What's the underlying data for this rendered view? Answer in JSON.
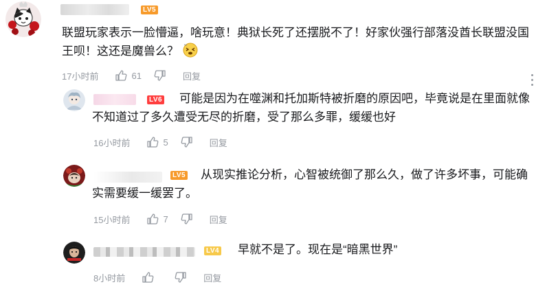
{
  "comments": [
    {
      "level": "LV5",
      "level_color": "#f79a2a",
      "text": "联盟玩家表示一脸懵逼，啥玩意！典狱长死了还摆脱不了！好家伙强行部落没酋长联盟没国王呗！这还是魔兽么？",
      "emoji_icon": "dizzy-face-emoji-icon",
      "time": "17小时前",
      "likes": "61",
      "reply_label": "回复"
    },
    {
      "level": "LV6",
      "level_color": "#ff3e3e",
      "text": "可能是因为在噬渊和托加斯特被折磨的原因吧，毕竟说是在里面就像不知道过了多久遭受无尽的折磨，受了那么多罪，缓缓也好",
      "time": "16小时前",
      "likes": "5",
      "reply_label": "回复"
    },
    {
      "level": "LV5",
      "level_color": "#f79a2a",
      "text": "从现实推论分析，心智被统御了那么久，做了许多坏事，可能确实需要缓一缓罢了。",
      "time": "15小时前",
      "likes": "7",
      "reply_label": "回复"
    },
    {
      "level": "LV4",
      "level_color": "#f7c94a",
      "text": "早就不是了。现在是“暗黑世界”",
      "time": "8小时前",
      "likes": "",
      "reply_label": "回复"
    }
  ],
  "icons": {
    "like": "thumbs-up-icon",
    "dislike": "thumbs-down-icon",
    "more": "more-vertical-icon"
  }
}
